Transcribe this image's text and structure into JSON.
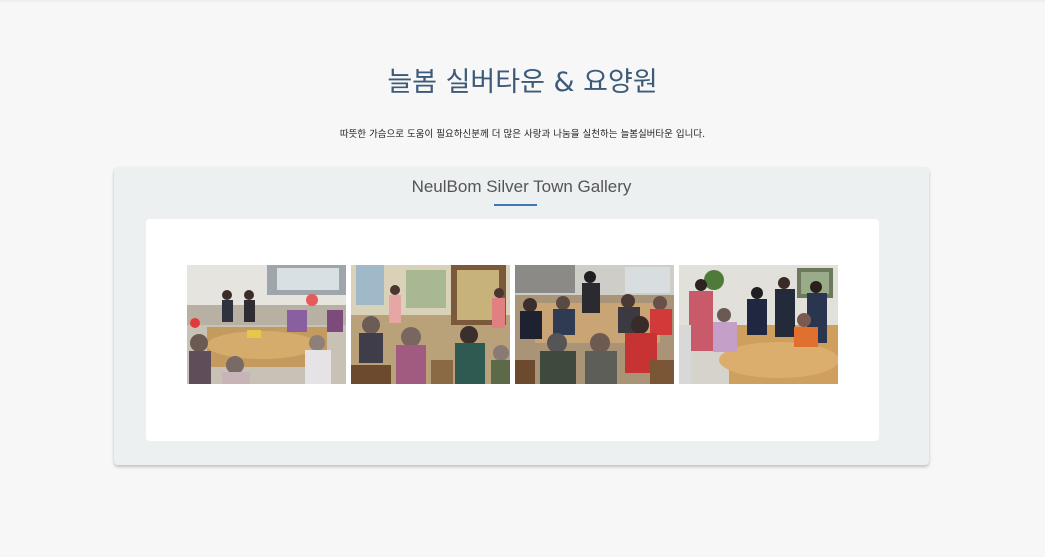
{
  "header": {
    "title": "늘봄 실버타운 & 요양원",
    "subtitle": "따뜻한 가슴으로 도움이 필요하신분께 더 많은 사랑과 나눔을 실천하는 늘봄실버타운 입니다."
  },
  "gallery": {
    "title": "NeulBom Silver Town Gallery",
    "accent_color": "#3f76b4",
    "photos": [
      {
        "name": "gallery-photo-1"
      },
      {
        "name": "gallery-photo-2"
      },
      {
        "name": "gallery-photo-3"
      },
      {
        "name": "gallery-photo-4"
      }
    ]
  }
}
